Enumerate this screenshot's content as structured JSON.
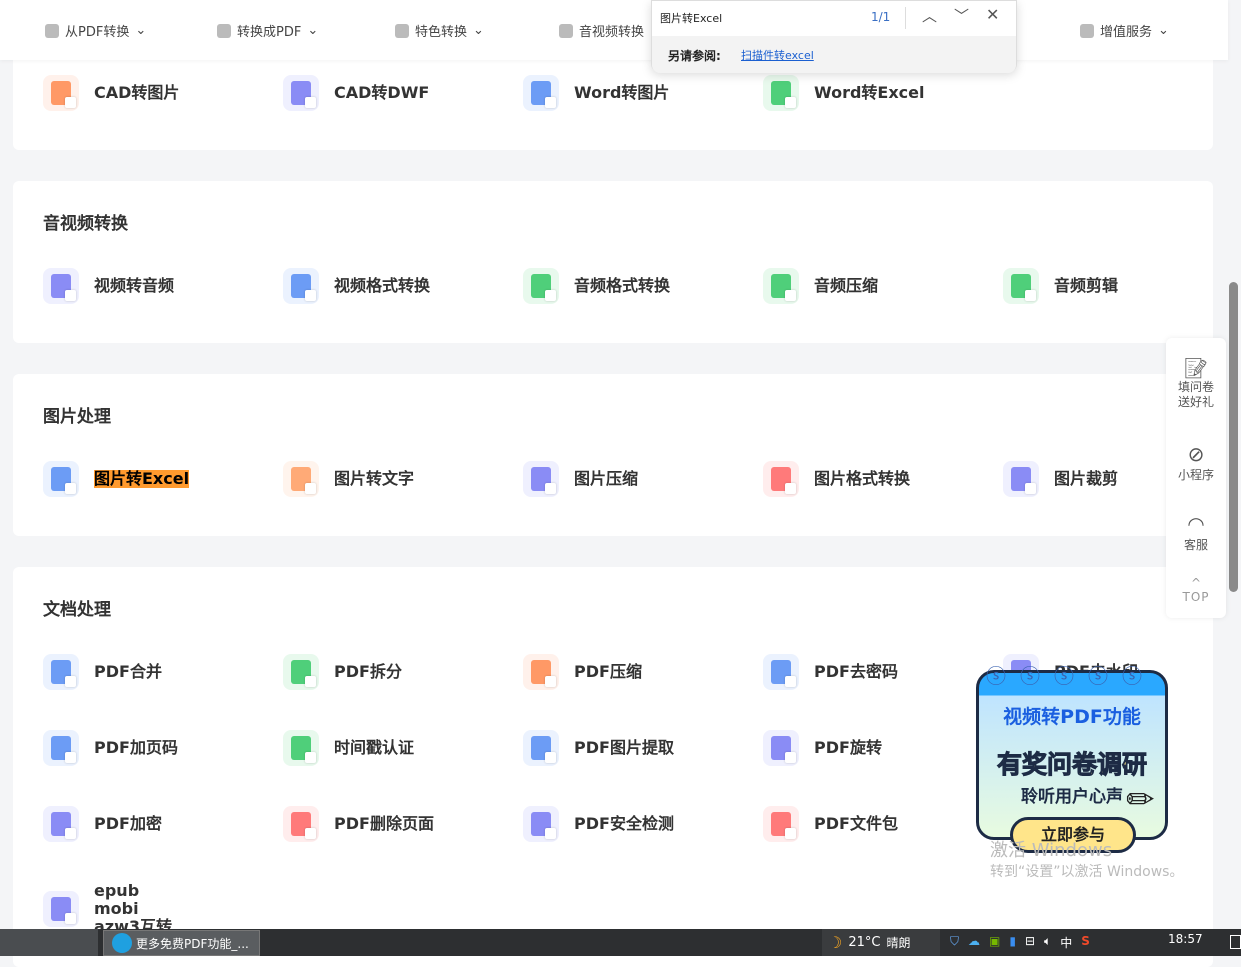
{
  "header": {
    "nav": [
      {
        "label": "从PDF转换",
        "icon": "pdf-icon"
      },
      {
        "label": "转换成PDF",
        "icon": "pdf-icon"
      },
      {
        "label": "特色转换",
        "icon": "star-shield-icon"
      },
      {
        "label": "音视频转换",
        "icon": "media-icon"
      },
      {
        "label": "增值服务",
        "icon": "list-icon"
      }
    ]
  },
  "find_bar": {
    "query": "图片转Excel",
    "count": "1/1",
    "see_also_label": "另请参阅:",
    "see_also_link": "扫描件转excel"
  },
  "sections": [
    {
      "title": "",
      "items": [
        {
          "label": "CAD转图片",
          "color": "#ff9966"
        },
        {
          "label": "CAD转DWF",
          "color": "#8a8cf5"
        },
        {
          "label": "Word转图片",
          "color": "#6c9cf5"
        },
        {
          "label": "Word转Excel",
          "color": "#4fcf7a"
        }
      ]
    },
    {
      "title": "音视频转换",
      "items": [
        {
          "label": "视频转音频",
          "color": "#8a8cf5"
        },
        {
          "label": "视频格式转换",
          "color": "#6c9cf5"
        },
        {
          "label": "音频格式转换",
          "color": "#4fcf7a"
        },
        {
          "label": "音频压缩",
          "color": "#4fcf7a"
        },
        {
          "label": "音频剪辑",
          "color": "#4fcf7a"
        }
      ]
    },
    {
      "title": "图片处理",
      "items": [
        {
          "label": "图片转Excel",
          "color": "#6c9cf5",
          "highlight": true
        },
        {
          "label": "图片转文字",
          "color": "#ffaa77"
        },
        {
          "label": "图片压缩",
          "color": "#8a8cf5"
        },
        {
          "label": "图片格式转换",
          "color": "#ff7a7a"
        },
        {
          "label": "图片裁剪",
          "color": "#8a8cf5"
        }
      ]
    },
    {
      "title": "文档处理",
      "items": [
        {
          "label": "PDF合并",
          "color": "#6c9cf5"
        },
        {
          "label": "PDF拆分",
          "color": "#4fcf7a"
        },
        {
          "label": "PDF压缩",
          "color": "#ff9966"
        },
        {
          "label": "PDF去密码",
          "color": "#6c9cf5"
        },
        {
          "label": "PDF去水印",
          "color": "#8a8cf5"
        },
        {
          "label": "PDF加页码",
          "color": "#6c9cf5"
        },
        {
          "label": "时间戳认证",
          "color": "#4fcf7a"
        },
        {
          "label": "PDF图片提取",
          "color": "#6c9cf5"
        },
        {
          "label": "PDF旋转",
          "color": "#8a8cf5"
        },
        {
          "label": "PDF加密",
          "color": "#8a8cf5"
        },
        {
          "label": "PDF删除页面",
          "color": "#ff7a7a"
        },
        {
          "label": "PDF安全检测",
          "color": "#8a8cf5"
        },
        {
          "label": "PDF文件包",
          "color": "#ff7a7a"
        },
        {
          "label": "epub mobi azw3互转",
          "color": "#8a8cf5"
        }
      ]
    }
  ],
  "side": [
    {
      "label": "填问卷送好礼",
      "icon": "survey-icon"
    },
    {
      "label": "小程序",
      "icon": "mini-program-icon"
    },
    {
      "label": "客服",
      "icon": "headset-icon"
    },
    {
      "label": "TOP",
      "icon": "chevron-up-icon"
    }
  ],
  "promo": {
    "title": "视频转PDF功能",
    "headline": "有奖问卷调研",
    "sub": "聆听用户心声",
    "button": "立即参与"
  },
  "watermark": {
    "line1": "激活 Windows",
    "line2": "转到“设置”以激活 Windows。"
  },
  "taskbar": {
    "app": "更多免费PDF功能_...",
    "weather_temp": "21°C",
    "weather_text": "晴朗",
    "ime": "中",
    "time": "18:57"
  }
}
